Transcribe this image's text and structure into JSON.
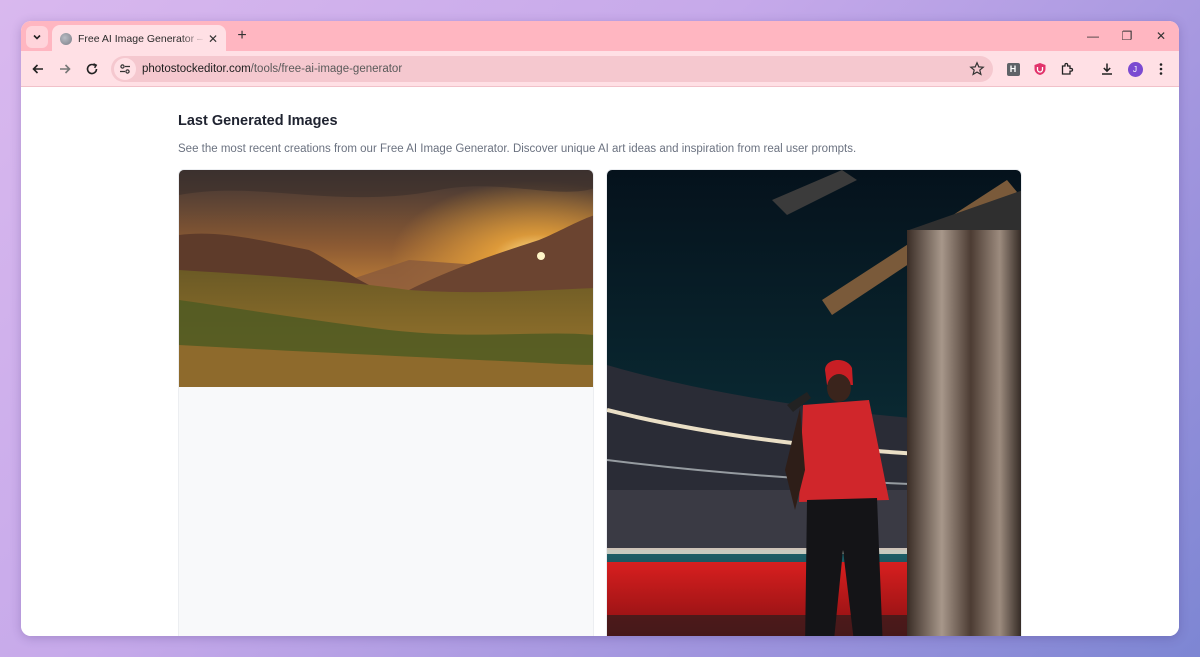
{
  "browser": {
    "tab": {
      "title": "Free AI Image Generator – Create",
      "close_glyph": "✕"
    },
    "new_tab_glyph": "+",
    "window_controls": {
      "minimize": "—",
      "restore": "❐",
      "close": "✕"
    },
    "address": {
      "host": "photostockeditor.com",
      "path": "/tools/free-ai-image-generator"
    },
    "extensions": {
      "h_label": "H"
    },
    "profile_initial": "J"
  },
  "page": {
    "section_title": "Last Generated Images",
    "section_description": "See the most recent creations from our Free AI Image Generator. Discover unique AI art ideas and inspiration from real user prompts.",
    "images": [
      {
        "subject": "sunset over desert mountain valley"
      },
      {
        "subject": "performer in red jersey on stadium stage"
      }
    ]
  },
  "colors": {
    "tab_strip": "#ffb6c1",
    "toolbar": "#ffe0e5",
    "omnibox": "#f5c8cf",
    "title_text": "#1f2330",
    "description_text": "#6b7280"
  }
}
